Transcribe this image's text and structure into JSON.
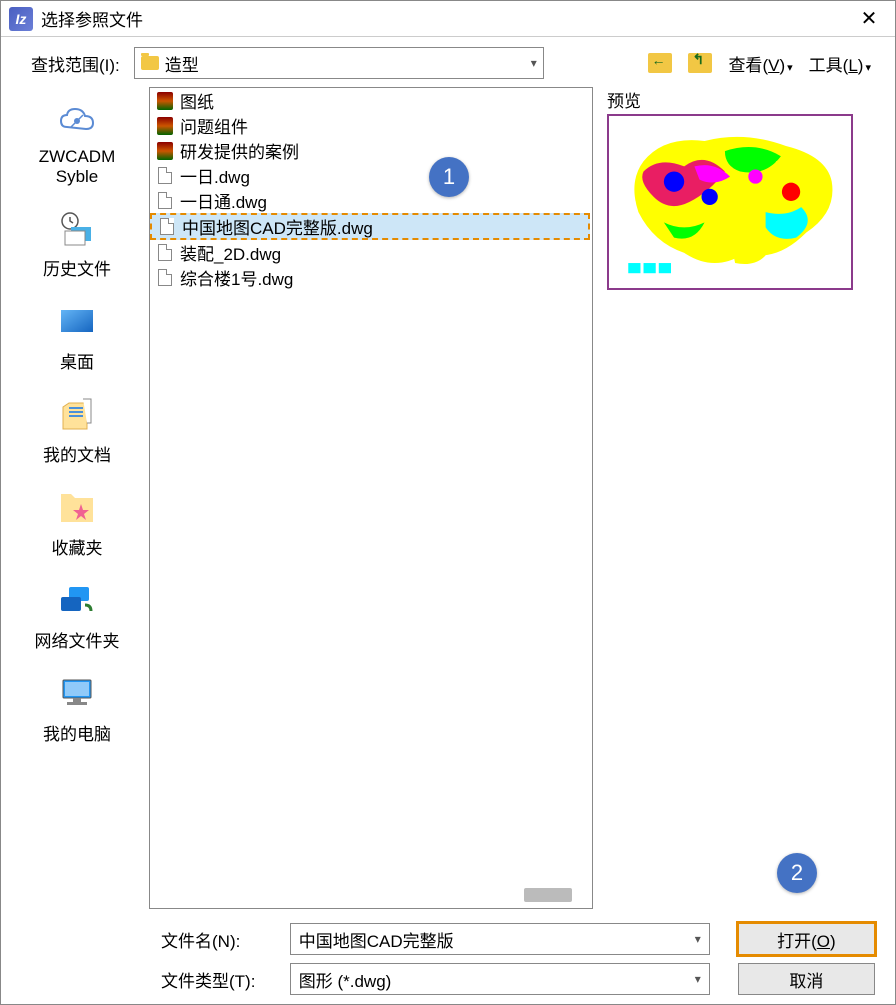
{
  "window": {
    "title": "选择参照文件"
  },
  "toolbar": {
    "range_label": "查找范围(I):",
    "current_folder": "造型",
    "view_label": "查看",
    "view_key": "V",
    "tools_label": "工具",
    "tools_key": "L"
  },
  "sidebar": [
    {
      "id": "syble",
      "label": "ZWCADM Syble"
    },
    {
      "id": "history",
      "label": "历史文件"
    },
    {
      "id": "desktop",
      "label": "桌面"
    },
    {
      "id": "docs",
      "label": "我的文档"
    },
    {
      "id": "fav",
      "label": "收藏夹"
    },
    {
      "id": "net",
      "label": "网络文件夹"
    },
    {
      "id": "pc",
      "label": "我的电脑"
    }
  ],
  "files": [
    {
      "name": "图纸",
      "type": "archive"
    },
    {
      "name": "问题组件",
      "type": "archive"
    },
    {
      "name": "研发提供的案例",
      "type": "archive"
    },
    {
      "name": "一日.dwg",
      "type": "file"
    },
    {
      "name": "一日通.dwg",
      "type": "file"
    },
    {
      "name": "中国地图CAD完整版.dwg",
      "type": "file",
      "selected": true
    },
    {
      "name": "装配_2D.dwg",
      "type": "file"
    },
    {
      "name": "综合楼1号.dwg",
      "type": "file"
    }
  ],
  "preview": {
    "label": "预览"
  },
  "bottom": {
    "filename_label": "文件名(N):",
    "filename_value": "中国地图CAD完整版",
    "filetype_label": "文件类型(T):",
    "filetype_value": "图形 (*.dwg)",
    "open_label": "打开(O)",
    "cancel_label": "取消"
  },
  "callouts": {
    "c1": "1",
    "c2": "2"
  }
}
